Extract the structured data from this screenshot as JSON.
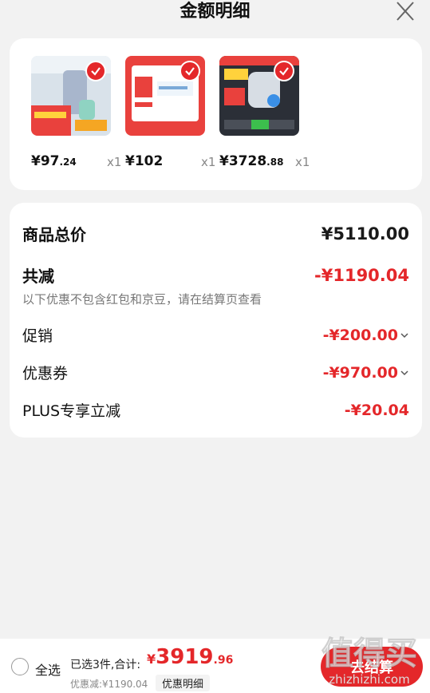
{
  "header": {
    "title": "金额明细"
  },
  "products": [
    {
      "price_int": "¥97",
      "price_dec": ".24",
      "qty": "x1",
      "thumb_color": "#d9e2ea"
    },
    {
      "price_int": "¥102",
      "price_dec": "",
      "qty": "x1",
      "thumb_color": "#e9413d"
    },
    {
      "price_int": "¥3728",
      "price_dec": ".88",
      "qty": "x1",
      "thumb_color": "#2b2f37"
    }
  ],
  "summary": {
    "total_label": "商品总价",
    "total_value": "¥5110.00",
    "reduce_label": "共减",
    "reduce_value": "-¥1190.04",
    "note": "以下优惠不包含红包和京豆，请在结算页查看",
    "promo_label": "促销",
    "promo_value": "-¥200.00",
    "coupon_label": "优惠券",
    "coupon_value": "-¥970.00",
    "plus_label": "PLUS专享立减",
    "plus_value": "-¥20.04"
  },
  "bottom": {
    "select_all": "全选",
    "selected_info": "已选3件,合计:",
    "total_currency": "¥",
    "total_int": "3919",
    "total_dec": ".96",
    "discount": "优惠减:¥1190.04",
    "detail_button": "优惠明细",
    "checkout_button": "去结算",
    "watermark": "值得买",
    "watermark_url": "zhizhizhi.com"
  },
  "colors": {
    "accent": "#e4272a",
    "background": "#f2f2f2"
  }
}
